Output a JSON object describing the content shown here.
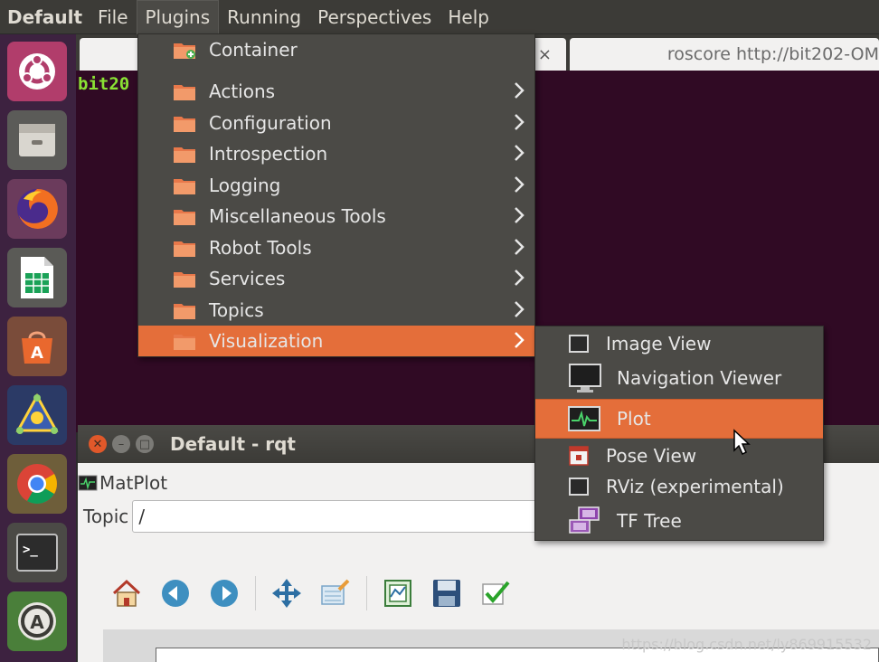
{
  "menubar": {
    "app_title": "Default",
    "menus": [
      "File",
      "Plugins",
      "Running",
      "Perspectives",
      "Help"
    ]
  },
  "launcher": {
    "items": [
      "ubuntu-dash",
      "files",
      "firefox",
      "libreoffice-calc",
      "software-center",
      "ros-app",
      "chrome",
      "terminal",
      "software-updater"
    ]
  },
  "terminal": {
    "tab_close": "×",
    "tab_title": "roscore http://bit202-OM",
    "prompt": "bit20"
  },
  "plugins_menu": {
    "items": [
      {
        "label": "Container",
        "submenu": false
      },
      {
        "label": "Actions",
        "submenu": true
      },
      {
        "label": "Configuration",
        "submenu": true
      },
      {
        "label": "Introspection",
        "submenu": true
      },
      {
        "label": "Logging",
        "submenu": true
      },
      {
        "label": "Miscellaneous Tools",
        "submenu": true
      },
      {
        "label": "Robot Tools",
        "submenu": true
      },
      {
        "label": "Services",
        "submenu": true
      },
      {
        "label": "Topics",
        "submenu": true
      },
      {
        "label": "Visualization",
        "submenu": true,
        "highlighted": true
      }
    ]
  },
  "visualization_menu": {
    "items": [
      {
        "label": "Image View",
        "icon": "image-view-icon"
      },
      {
        "label": "Navigation Viewer",
        "icon": "monitor-icon"
      },
      {
        "label": "Plot",
        "icon": "plot-icon",
        "highlighted": true
      },
      {
        "label": "Pose View",
        "icon": "pose-view-icon"
      },
      {
        "label": "RViz (experimental)",
        "icon": "rviz-icon"
      },
      {
        "label": "TF Tree",
        "icon": "tf-tree-icon"
      }
    ]
  },
  "rqt_window": {
    "title": "Default - rqt",
    "plugin_name": "MatPlot",
    "topic_label": "Topic",
    "topic_value": "/",
    "toolbar": [
      "home-icon",
      "back-icon",
      "forward-icon",
      "pan-icon",
      "zoom-icon",
      "configure-subplots-icon",
      "save-icon",
      "check-icon"
    ]
  },
  "watermark": "https://blog.csdn.net/ly869915532",
  "colors": {
    "accent": "#e46e3a",
    "menu_bg": "#4b4a46",
    "menubar_bg": "#3c3b37",
    "launcher_bg": "#3d2240",
    "terminal_bg": "#300a24",
    "prompt_green": "#8ae234"
  }
}
